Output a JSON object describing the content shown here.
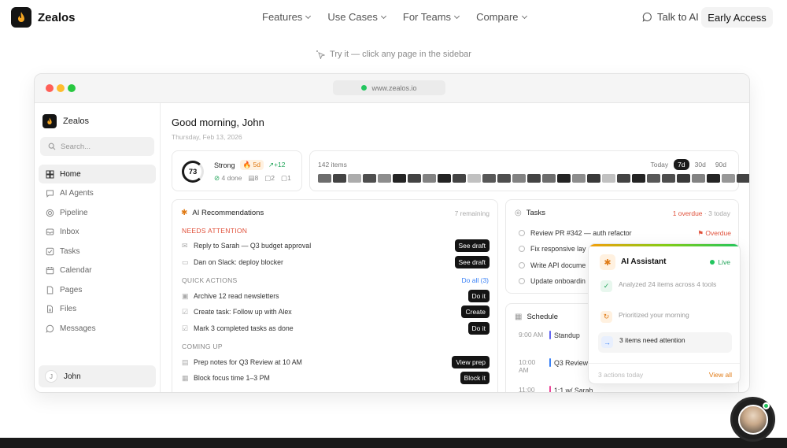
{
  "brand": {
    "name": "Zealos"
  },
  "nav": {
    "links": [
      "Features",
      "Use Cases",
      "For Teams",
      "Compare"
    ],
    "talk": "Talk to AI",
    "cta": "Early Access"
  },
  "hint": "Try it — click any page in the sidebar",
  "window": {
    "url": "www.zealos.io"
  },
  "sidebar": {
    "brand": "Zealos",
    "search_placeholder": "Search...",
    "items": [
      {
        "label": "Home",
        "icon": "grid-icon"
      },
      {
        "label": "AI Agents",
        "icon": "chat-icon"
      },
      {
        "label": "Pipeline",
        "icon": "target-icon"
      },
      {
        "label": "Inbox",
        "icon": "inbox-icon"
      },
      {
        "label": "Tasks",
        "icon": "checkbox-icon"
      },
      {
        "label": "Calendar",
        "icon": "calendar-icon"
      },
      {
        "label": "Pages",
        "icon": "document-icon"
      },
      {
        "label": "Files",
        "icon": "folder-icon"
      },
      {
        "label": "Messages",
        "icon": "message-icon"
      }
    ],
    "user": {
      "initial": "J",
      "name": "John"
    }
  },
  "main": {
    "greeting": "Good morning, John",
    "date": "Thursday, Feb 13, 2026",
    "score": {
      "value": "73",
      "label": "Strong",
      "streak": "5d",
      "trend": "+12",
      "done": "4 done",
      "a": "8",
      "b": "2",
      "c": "1"
    },
    "heat": {
      "label": "142 items",
      "ranges": [
        "Today",
        "7d",
        "30d",
        "90d"
      ],
      "active_range": "7d",
      "levels": [
        0.6,
        0.8,
        0.3,
        0.75,
        0.45,
        0.95,
        0.8,
        0.5,
        0.95,
        0.8,
        0.2,
        0.7,
        0.75,
        0.5,
        0.8,
        0.6,
        0.95,
        0.45,
        0.85,
        0.2,
        0.8,
        0.95,
        0.7,
        0.75,
        0.85,
        0.5,
        0.95,
        0.4,
        0.8,
        0.7
      ]
    },
    "recs": {
      "title": "AI Recommendations",
      "remaining": "7 remaining",
      "needs_attention": "NEEDS ATTENTION",
      "attention": [
        {
          "text": "Reply to Sarah — Q3 budget approval",
          "action": "See draft",
          "icon": "mail-icon"
        },
        {
          "text": "Dan on Slack: deploy blocker",
          "action": "See draft",
          "icon": "chat-icon"
        }
      ],
      "quick_actions": "QUICK ACTIONS",
      "do_all": "Do all (3)",
      "quick": [
        {
          "text": "Archive 12 read newsletters",
          "action": "Do it",
          "icon": "archive-icon"
        },
        {
          "text": "Create task: Follow up with Alex",
          "action": "Create",
          "icon": "checkbox-icon"
        },
        {
          "text": "Mark 3 completed tasks as done",
          "action": "Do it",
          "icon": "checkbox-icon"
        }
      ],
      "coming_up": "COMING UP",
      "upcoming": [
        {
          "text": "Prep notes for Q3 Review at 10 AM",
          "action": "View prep",
          "icon": "document-icon"
        },
        {
          "text": "Block focus time 1–3 PM",
          "action": "Block it",
          "icon": "calendar-icon"
        }
      ]
    },
    "tasks": {
      "title": "Tasks",
      "overdue": "1 overdue",
      "today": "3 today",
      "items": [
        {
          "text": "Review PR #342 — auth refactor",
          "flag": "Overdue"
        },
        {
          "text": "Fix responsive lay",
          "flag": ""
        },
        {
          "text": "Write API docume",
          "flag": ""
        },
        {
          "text": "Update onboardin",
          "flag": ""
        }
      ]
    },
    "schedule": {
      "title": "Schedule",
      "events": [
        {
          "time": "9:00 AM",
          "title": "Standup",
          "color": "#6366f1"
        },
        {
          "time": "10:00 AM",
          "title": "Q3 Review",
          "color": "#3b82f6"
        },
        {
          "time": "11:00",
          "title": "1:1 w/ Sarah",
          "color": "#ec4899"
        }
      ]
    }
  },
  "assistant": {
    "title": "AI Assistant",
    "status": "Live",
    "items": [
      {
        "text": "Analyzed 24 items across 4 tools",
        "icon": "check-icon"
      },
      {
        "text": "Prioritized your morning",
        "icon": "refresh-icon"
      },
      {
        "text": "3 items need attention",
        "icon": "arrow-right-icon"
      }
    ],
    "footer": "3 actions today",
    "view_all": "View all"
  },
  "colors": {
    "accent": "#e07b16",
    "live": "#22a55a",
    "overdue": "#e0503a",
    "link": "#3b82f6"
  }
}
